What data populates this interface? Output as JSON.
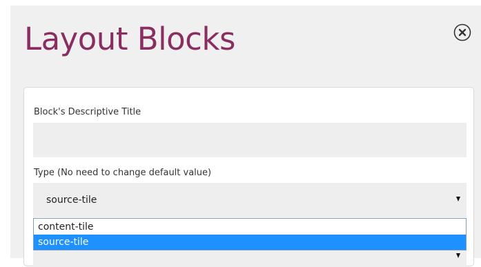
{
  "header": {
    "title": "Layout Blocks",
    "close_icon": "close-circle-icon"
  },
  "form": {
    "title_field": {
      "label": "Block's Descriptive Title",
      "value": "",
      "placeholder": ""
    },
    "type_field": {
      "label": "Type (No need to change default value)",
      "value": "source-tile",
      "options": [
        "content-tile",
        "source-tile"
      ],
      "highlighted_option": "source-tile"
    }
  },
  "colors": {
    "title": "#8a2e62",
    "highlight": "#1e90ff",
    "panel_bg": "#f0f0f0",
    "field_bg": "#eeeeee"
  }
}
